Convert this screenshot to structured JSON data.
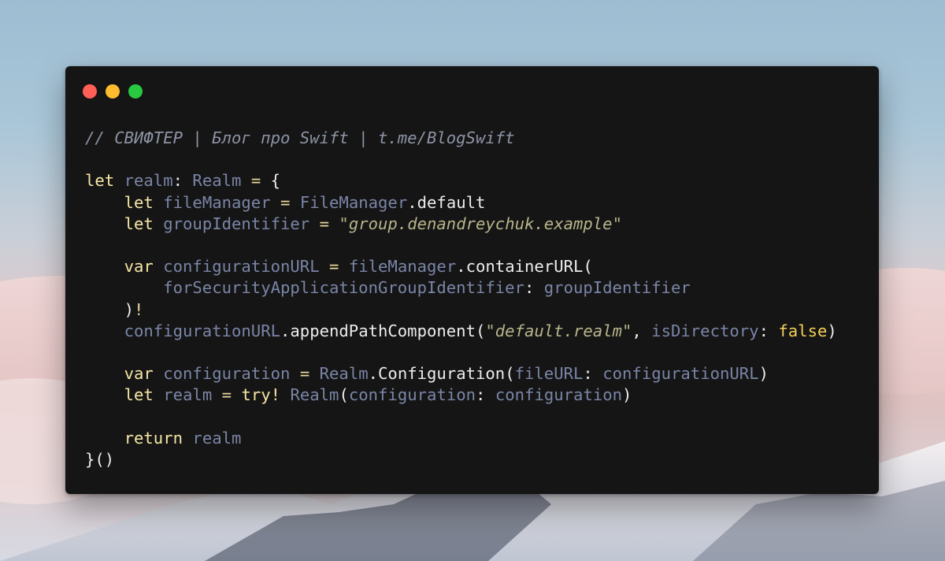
{
  "window": {
    "traffic_lights": [
      {
        "name": "close",
        "color": "#ff5f57"
      },
      {
        "name": "minimize",
        "color": "#febc2e"
      },
      {
        "name": "zoom",
        "color": "#28c840"
      }
    ]
  },
  "code": {
    "lines": [
      "// СВИФТЕР | Блог про Swift | t.me/BlogSwift",
      "",
      "let realm: Realm = {",
      "    let fileManager = FileManager.default",
      "    let groupIdentifier = \"group.denandreychuk.example\"",
      "",
      "    var configurationURL = fileManager.containerURL(",
      "        forSecurityApplicationGroupIdentifier: groupIdentifier",
      "    )!",
      "    configurationURL.appendPathComponent(\"default.realm\", isDirectory: false)",
      "",
      "    var configuration = Realm.Configuration(fileURL: configurationURL)",
      "    let realm = try! Realm(configuration: configuration)",
      "",
      "    return realm",
      "}()"
    ]
  },
  "colors": {
    "background": "#151515",
    "keyword": "#f6e6a6",
    "identifier": "#7a85a6",
    "string": "#b7b48a",
    "comment": "#8d93a4",
    "boolean": "#f3cf5a",
    "plain": "#ececec"
  }
}
